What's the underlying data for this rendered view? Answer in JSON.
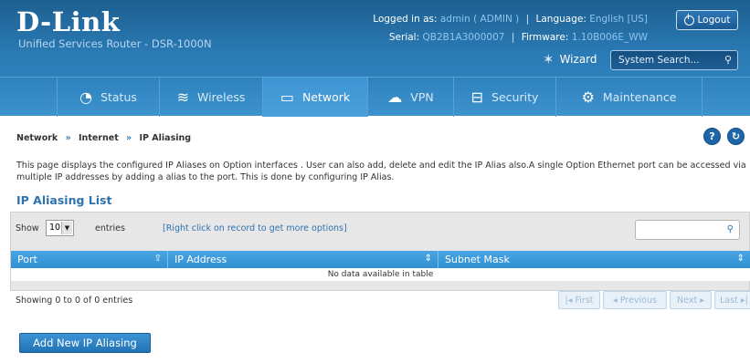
{
  "header": {
    "brand": "D-Link",
    "product": "Unified Services Router - DSR-1000N",
    "logged_in_label": "Logged in as:",
    "user": "admin ( ADMIN )",
    "language_label": "Language:",
    "language": "English [US]",
    "serial_label": "Serial:",
    "serial": "QB2B1A3000007",
    "firmware_label": "Firmware:",
    "firmware": "1.10B006E_WW",
    "logout_label": "Logout",
    "wizard_label": "Wizard",
    "search_placeholder": "System Search..."
  },
  "nav": [
    {
      "label": "Status",
      "icon": "dashboard-icon"
    },
    {
      "label": "Wireless",
      "icon": "wifi-icon"
    },
    {
      "label": "Network",
      "icon": "monitor-icon",
      "active": true
    },
    {
      "label": "VPN",
      "icon": "cloud-lock-icon"
    },
    {
      "label": "Security",
      "icon": "lock-icon"
    },
    {
      "label": "Maintenance",
      "icon": "gears-icon"
    }
  ],
  "breadcrumb": {
    "items": [
      "Network",
      "Internet",
      "IP Aliasing"
    ],
    "separator": "»"
  },
  "help_label": "?",
  "refresh_label": "↻",
  "description": "This page displays the configured IP Aliases on Option interfaces . User can also add, delete and edit the IP Alias also.A single Option Ethernet port can be accessed via multiple IP addresses by adding a alias to the port. This is done by configuring IP Alias.",
  "section_title": "IP Aliasing List",
  "table": {
    "show_label": "Show",
    "page_size": "10",
    "entries_label": "entries",
    "hint": "[Right click on record to get more options]",
    "columns": [
      "Port",
      "IP Address",
      "Subnet Mask"
    ],
    "empty_text": "No data available in table",
    "info": "Showing 0 to 0 of 0 entries",
    "pager": {
      "first": "First",
      "previous": "Previous",
      "next": "Next",
      "last": "Last"
    }
  },
  "add_button_label": "Add New IP Aliasing"
}
